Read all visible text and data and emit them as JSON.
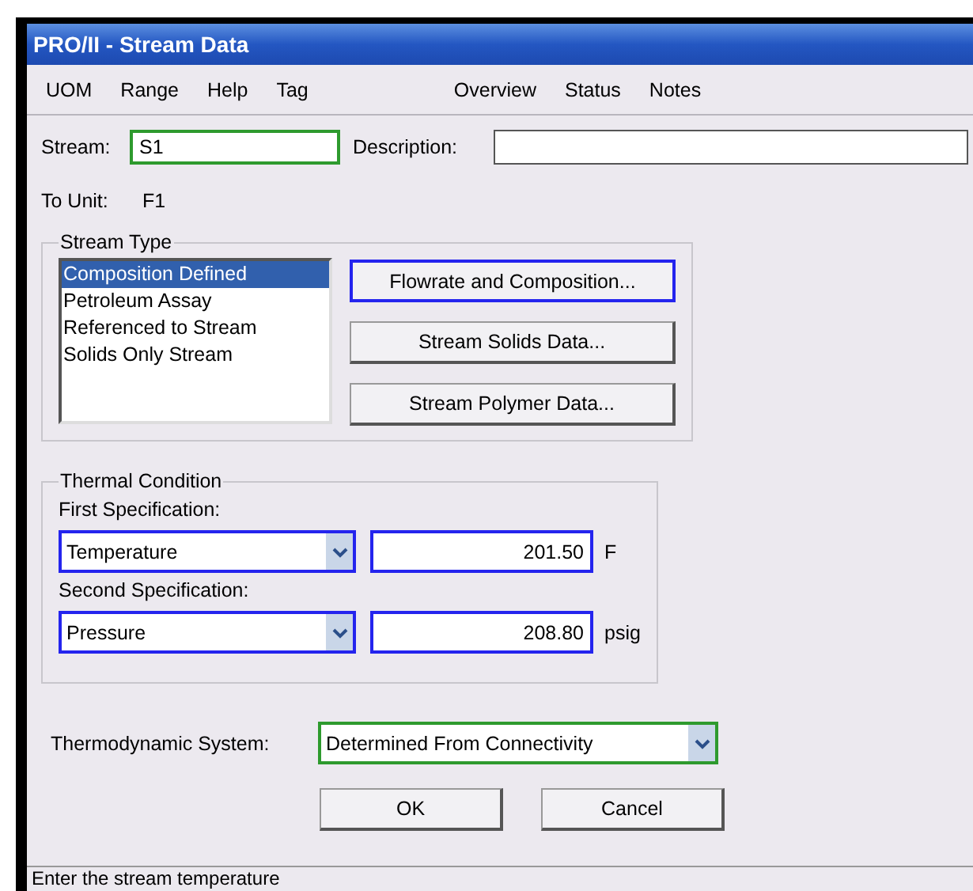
{
  "window": {
    "title": "PRO/II - Stream Data"
  },
  "menu": {
    "left": [
      "UOM",
      "Range",
      "Help",
      "Tag"
    ],
    "right": [
      "Overview",
      "Status",
      "Notes"
    ]
  },
  "stream": {
    "label": "Stream:",
    "value": "S1",
    "description_label": "Description:"
  },
  "to_unit": {
    "label": "To Unit:",
    "value": "F1"
  },
  "stream_type": {
    "title": "Stream Type",
    "items": [
      {
        "label": "Composition Defined",
        "selected": true
      },
      {
        "label": "Petroleum Assay",
        "selected": false
      },
      {
        "label": "Referenced to Stream",
        "selected": false
      },
      {
        "label": "Solids Only Stream",
        "selected": false
      }
    ],
    "buttons": [
      "Flowrate and Composition...",
      "Stream Solids Data...",
      "Stream Polymer Data..."
    ]
  },
  "thermal": {
    "title": "Thermal Condition",
    "specs": [
      {
        "label": "First Specification:",
        "option": "Temperature",
        "value": "201.50",
        "unit": "F"
      },
      {
        "label": "Second Specification:",
        "option": "Pressure",
        "value": "208.80",
        "unit": "psig"
      }
    ]
  },
  "thermo": {
    "label": "Thermodynamic System:",
    "value": "Determined From Connectivity"
  },
  "buttons": [
    "OK",
    "Cancel"
  ],
  "status_bar": "Enter the stream temperature"
}
